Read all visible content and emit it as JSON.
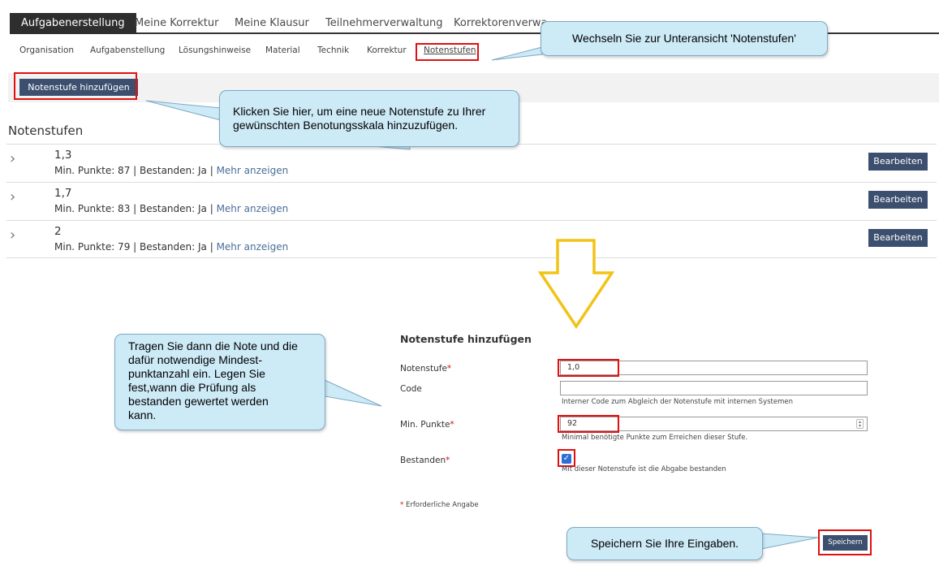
{
  "tabs": [
    {
      "label": "Aufgabenerstellung"
    },
    {
      "label": "Meine Korrektur"
    },
    {
      "label": "Meine Klausur"
    },
    {
      "label": "Teilnehmerverwaltung"
    },
    {
      "label": "Korrektorenverwa"
    }
  ],
  "subnav": [
    {
      "label": "Organisation"
    },
    {
      "label": "Aufgabenstellung"
    },
    {
      "label": "Lösungshinweise"
    },
    {
      "label": "Material"
    },
    {
      "label": "Technik"
    },
    {
      "label": "Korrektur"
    },
    {
      "label": "Notenstufen"
    }
  ],
  "toolbar": {
    "add_label": "Notenstufe hinzufügen"
  },
  "section_title": "Notenstufen",
  "grades": [
    {
      "grade": "1,3",
      "meta": "Min. Punkte: 87 | Bestanden: Ja | ",
      "more": "Mehr anzeigen",
      "edit": "Bearbeiten"
    },
    {
      "grade": "1,7",
      "meta": "Min. Punkte: 83 | Bestanden: Ja | ",
      "more": "Mehr anzeigen",
      "edit": "Bearbeiten"
    },
    {
      "grade": "2",
      "meta": "Min. Punkte: 79 | Bestanden: Ja | ",
      "more": "Mehr anzeigen",
      "edit": "Bearbeiten"
    }
  ],
  "callouts": {
    "c1": "Wechseln Sie zur Unteransicht 'Notenstufen'",
    "c2a": "Klicken Sie hier, um eine neue Notenstufe zu Ihrer",
    "c2b": "gewünschten Benotungsskala hinzuzufügen.",
    "c3": [
      "Tragen Sie dann die Note und die",
      "dafür notwendige Mindest-",
      "punktanzahl ein. Legen Sie",
      "fest,wann die Prüfung als",
      "bestanden gewertet werden",
      "kann."
    ],
    "c4": "Speichern Sie Ihre Eingaben."
  },
  "form": {
    "title": "Notenstufe hinzufügen",
    "notenstufe_label": "Notenstufe",
    "notenstufe_value": "1,0",
    "code_label": "Code",
    "code_value": "",
    "code_help": "Interner Code zum Abgleich der Notenstufe mit internen Systemen",
    "punkte_label": "Min. Punkte",
    "punkte_value": "92",
    "punkte_help": "Minimal benötigte Punkte zum Erreichen dieser Stufe.",
    "bestanden_label": "Bestanden",
    "bestanden_checked": true,
    "bestanden_help": "Mit dieser Notenstufe ist die Abgabe bestanden",
    "required_star": "*",
    "required_note": "Erforderliche Angabe",
    "save_label": "Speichern"
  },
  "colors": {
    "highlight": "#e01010",
    "callout_bg": "#cdeaf7",
    "button": "#3d4f6e",
    "arrow": "#f2c316"
  }
}
